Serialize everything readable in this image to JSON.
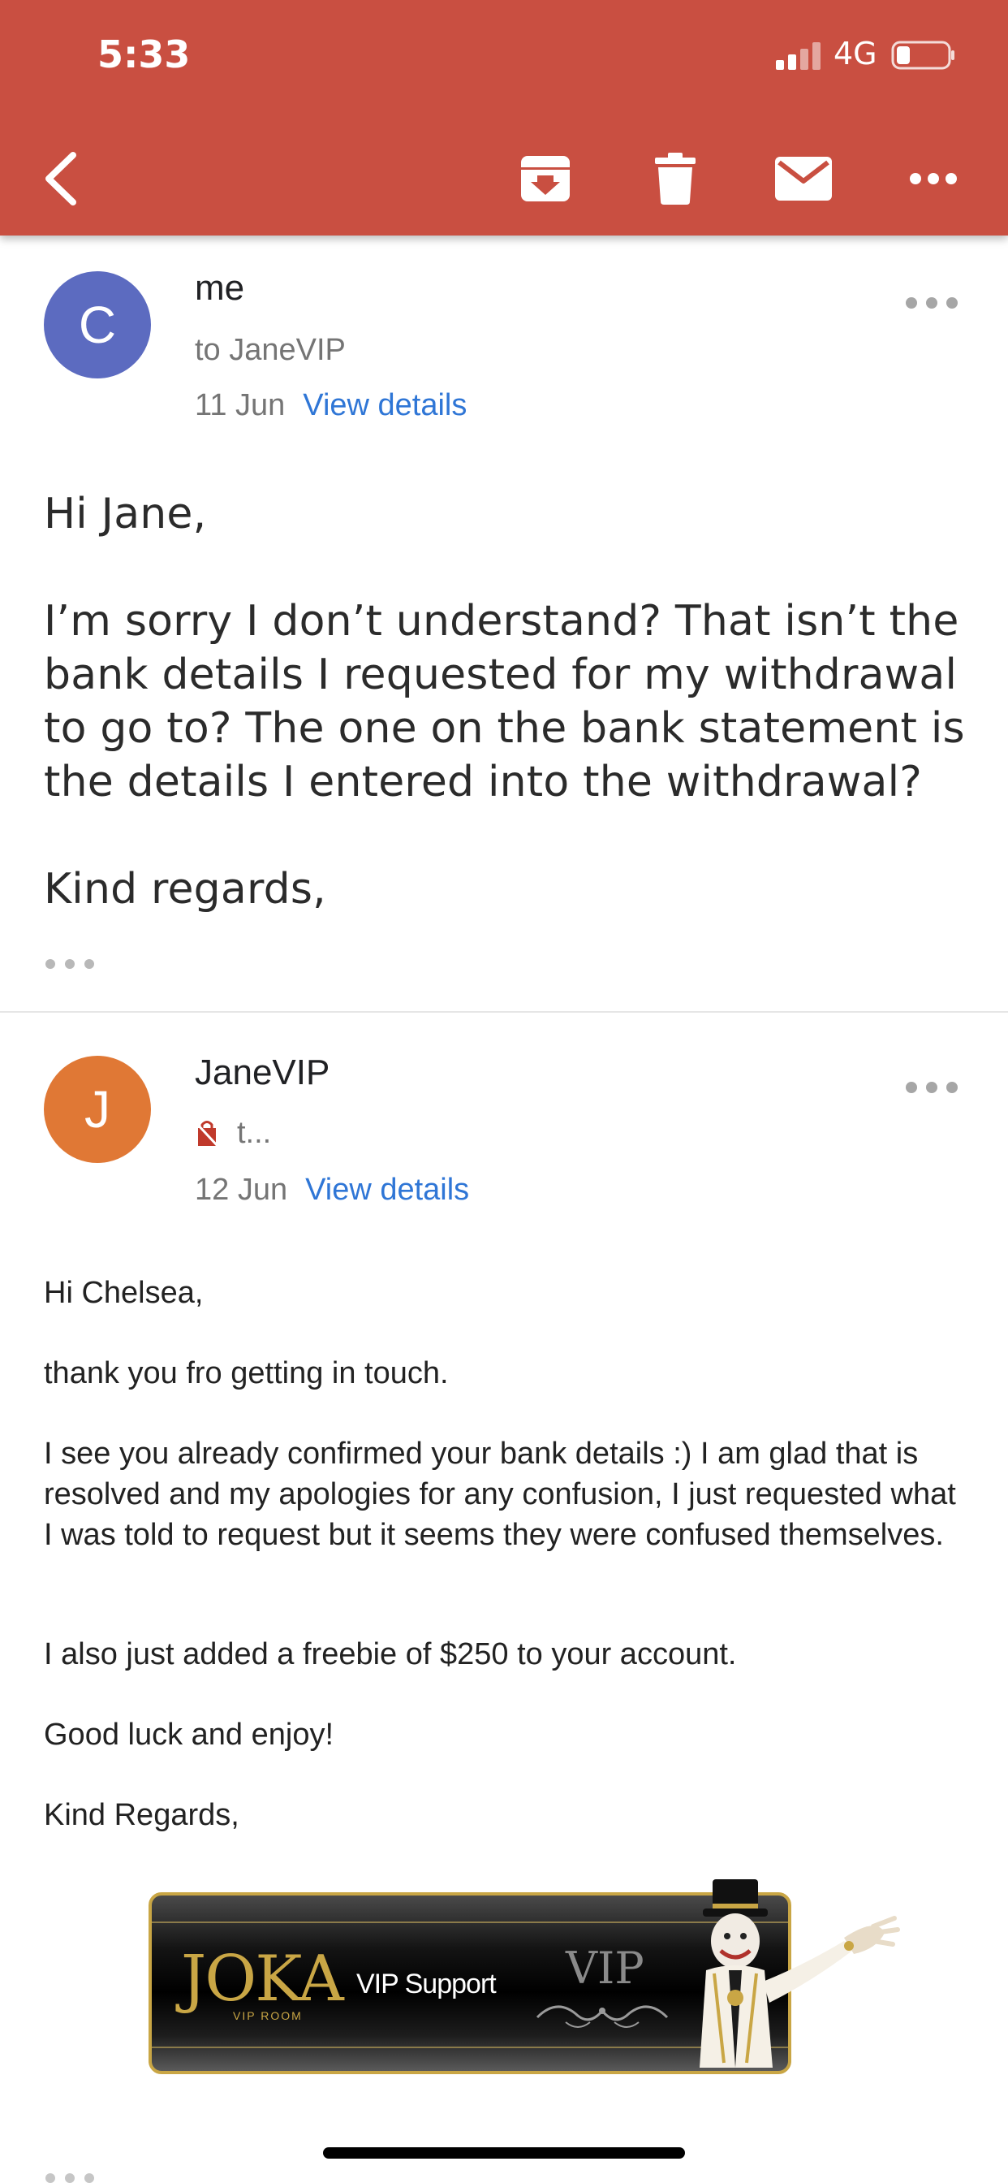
{
  "status_bar": {
    "time": "5:33",
    "network": "4G"
  },
  "toolbar": {
    "back_icon": "back-arrow-icon",
    "archive_icon": "archive-icon",
    "delete_icon": "trash-icon",
    "mark_unread_icon": "mail-icon",
    "more_icon": "more-horizontal-icon",
    "bar_color": "#c94f41"
  },
  "messages": [
    {
      "avatar_letter": "C",
      "avatar_color": "#5c6bc0",
      "sender": "me",
      "recipient": "to JaneVIP",
      "date": "11 Jun",
      "view_details": "View details",
      "body": {
        "greeting": "Hi Jane,",
        "paragraph": "I’m sorry I don’t understand? That isn’t the bank details I requested for my withdrawal to go to? The one on the bank statement is the details I entered into the withdrawal?",
        "signoff": "Kind regards,"
      }
    },
    {
      "avatar_letter": "J",
      "avatar_color": "#e07835",
      "sender": "JaneVIP",
      "recipient": "t...",
      "recipient_icon": "tag-icon",
      "date": "12 Jun",
      "view_details": "View details",
      "body": {
        "greeting": "Hi Chelsea,",
        "line1": "thank you fro getting in touch.",
        "line2": "I see you already confirmed your bank details :) I am glad that is resolved and my apologies for any confusion, I just requested what I was told to request but it seems they were confused themselves.",
        "line3": "I also just added a freebie of $250 to your account.",
        "line4": "Good luck and enjoy!",
        "signoff": "Kind Regards,"
      },
      "banner": {
        "logo": "JOKA",
        "logo_sub": "VIP ROOM",
        "support": "VIP Support",
        "vip": "VIP",
        "accent": "#c9a645"
      }
    }
  ]
}
